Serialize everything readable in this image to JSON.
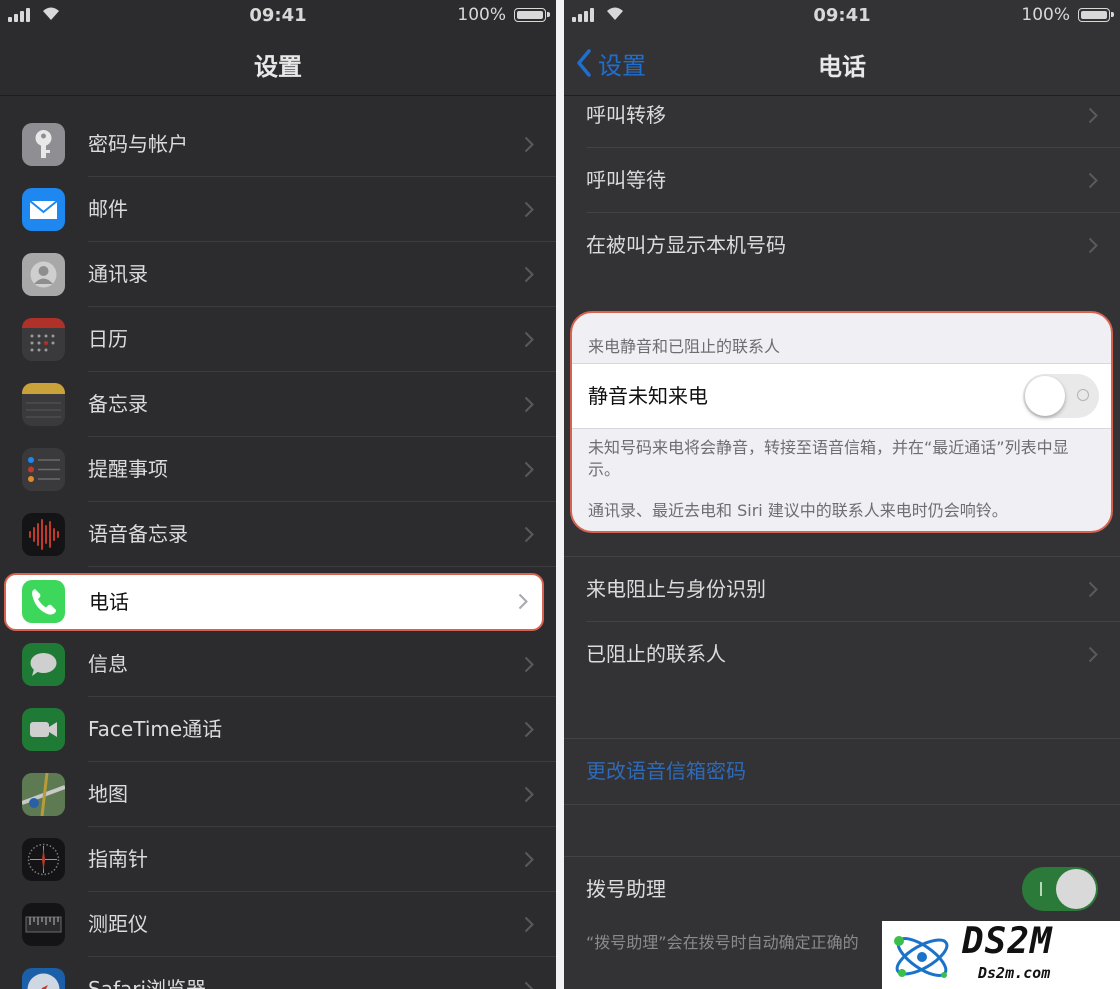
{
  "status": {
    "time": "09:41",
    "battery": "100%"
  },
  "left": {
    "title": "设置",
    "items": [
      {
        "label": "密码与帐户",
        "icon": "key-icon",
        "color": "#8e8e93"
      },
      {
        "label": "邮件",
        "icon": "mail-icon",
        "color": "#1e88f0"
      },
      {
        "label": "通讯录",
        "icon": "contacts-icon",
        "color": "#a8a8a8"
      },
      {
        "label": "日历",
        "icon": "calendar-icon",
        "color": "#ffffff"
      },
      {
        "label": "备忘录",
        "icon": "notes-icon",
        "color": "#fbd44b"
      },
      {
        "label": "提醒事项",
        "icon": "reminders-icon",
        "color": "#ffffff"
      },
      {
        "label": "语音备忘录",
        "icon": "voice-memos-icon",
        "color": "#1c1c1e"
      },
      {
        "label": "电话",
        "icon": "phone-icon",
        "color": "#34c759",
        "selected": true
      },
      {
        "label": "信息",
        "icon": "messages-icon",
        "color": "#34c759"
      },
      {
        "label": "FaceTime通话",
        "icon": "facetime-icon",
        "color": "#34c759"
      },
      {
        "label": "地图",
        "icon": "maps-icon",
        "color": "#8ac27a"
      },
      {
        "label": "指南针",
        "icon": "compass-icon",
        "color": "#1c1c1e"
      },
      {
        "label": "测距仪",
        "icon": "measure-icon",
        "color": "#1c1c1e"
      },
      {
        "label": "Safari浏览器",
        "icon": "safari-icon",
        "color": "#1e88f0"
      }
    ]
  },
  "right": {
    "back_label": "设置",
    "title": "电话",
    "top_items": [
      "呼叫转移",
      "呼叫等待",
      "在被叫方显示本机号码"
    ],
    "silence_section": {
      "header": "来电静音和已阻止的联系人",
      "row_label": "静音未知来电",
      "toggle_on": false,
      "footer1": "未知号码来电将会静音，转接至语音信箱，并在“最近通话”列表中显示。",
      "footer2": "通讯录、最近去电和 Siri 建议中的联系人来电时仍会响铃。"
    },
    "block_items": [
      "来电阻止与身份识别",
      "已阻止的联系人"
    ],
    "voicemail_link": "更改语音信箱密码",
    "dial_assist": {
      "label": "拨号助理",
      "toggle_on": true
    },
    "dial_assist_note": "“拨号助理”会在拨号时自动确定正确的"
  },
  "watermark": {
    "brand": "DS2M",
    "site": "Ds2m.com"
  }
}
